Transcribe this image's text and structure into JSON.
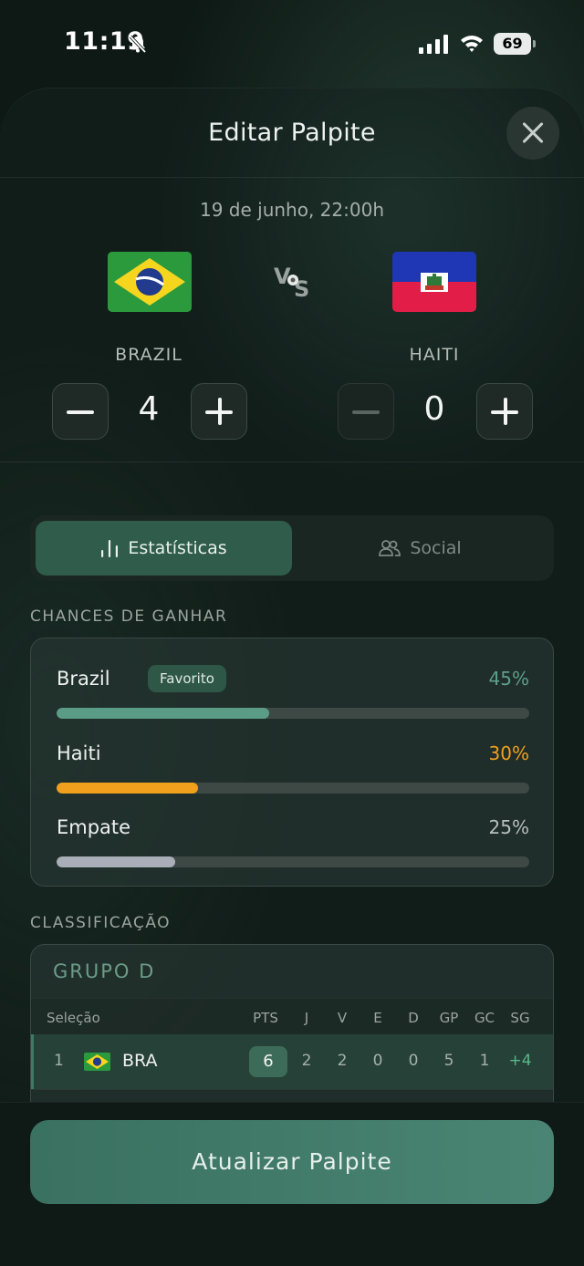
{
  "status_bar": {
    "time": "11:19",
    "battery": "69"
  },
  "sheet": {
    "title": "Editar Palpite"
  },
  "match": {
    "date": "19 de junho, 22:00h",
    "vs": "VS",
    "home": {
      "name": "BRAZIL",
      "score": "4",
      "flag": "brazil-flag"
    },
    "away": {
      "name": "HAITI",
      "score": "0",
      "flag": "haiti-flag"
    }
  },
  "tabs": [
    {
      "label": "Estatísticas",
      "icon": "bar-chart-icon",
      "active": true
    },
    {
      "label": "Social",
      "icon": "users-icon",
      "active": false
    }
  ],
  "chances": {
    "section_label": "CHANCES DE GANHAR",
    "items": [
      {
        "name": "Brazil",
        "badge": "Favorito",
        "percent_label": "45%",
        "value": 45,
        "color": "#5a9c85"
      },
      {
        "name": "Haiti",
        "percent_label": "30%",
        "value": 30,
        "color": "#f0a01c"
      },
      {
        "name": "Empate",
        "percent_label": "25%",
        "value": 25,
        "color": "#a9aeb8"
      }
    ]
  },
  "classification": {
    "section_label": "CLASSIFICAÇÃO",
    "group_title": "GRUPO D",
    "headers": [
      "Seleção",
      "PTS",
      "J",
      "V",
      "E",
      "D",
      "GP",
      "GC",
      "SG"
    ],
    "rows": [
      {
        "pos": "1",
        "team": "BRA",
        "flag": "brazil-flag",
        "pts": "6",
        "j": "2",
        "v": "2",
        "e": "0",
        "d": "0",
        "gp": "5",
        "gc": "1",
        "sg": "+4"
      }
    ]
  },
  "cta": {
    "label": "Atualizar Palpite"
  },
  "colors": {
    "accent": "#3f7a63",
    "favorite_bar": "#5a9c85",
    "haiti_bar": "#f0a01c",
    "draw_bar": "#a9aeb8"
  }
}
